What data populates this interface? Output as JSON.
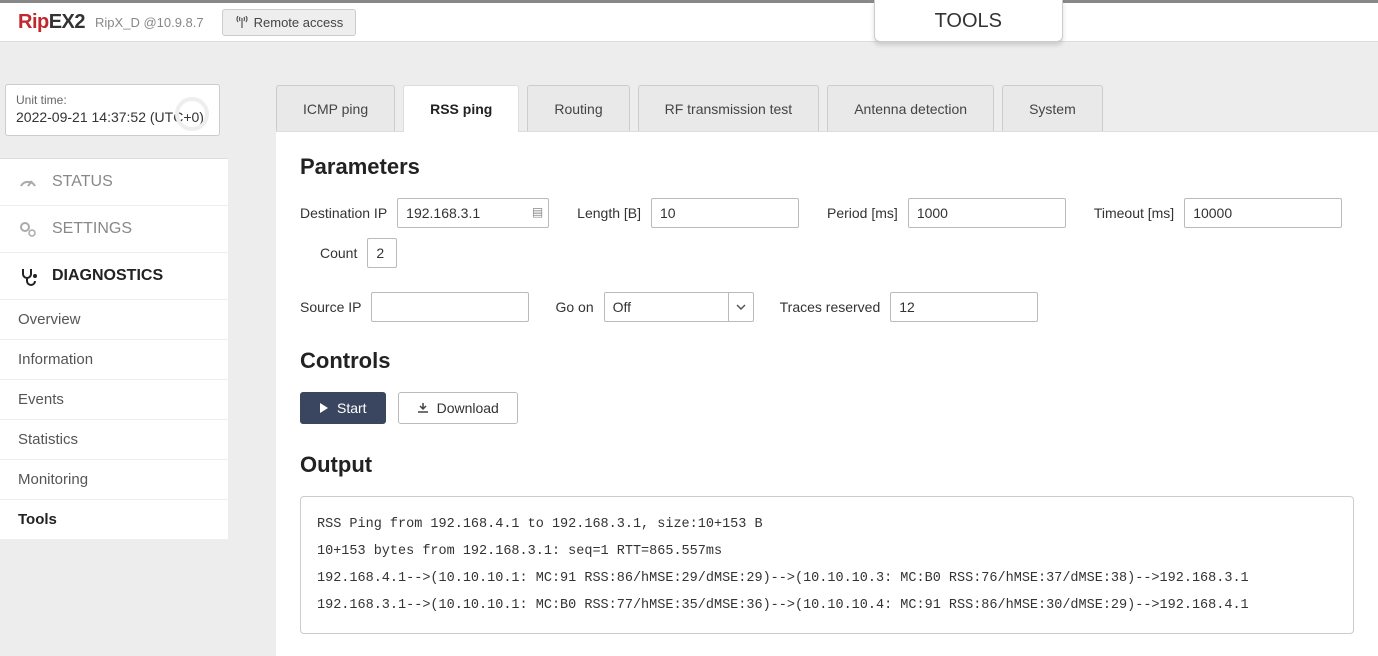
{
  "header": {
    "logo_a": "Rip",
    "logo_b": "EX2",
    "host": "RipX_D @10.9.8.7",
    "remote": "Remote access",
    "tab_right": "TOOLS"
  },
  "time": {
    "label": "Unit time:",
    "value": "2022-09-21 14:37:52 (UTC+0)"
  },
  "nav": {
    "status": "STATUS",
    "settings": "SETTINGS",
    "diagnostics": "DIAGNOSTICS",
    "sub": [
      "Overview",
      "Information",
      "Events",
      "Statistics",
      "Monitoring",
      "Tools"
    ]
  },
  "tabs": [
    "ICMP ping",
    "RSS ping",
    "Routing",
    "RF transmission test",
    "Antenna detection",
    "System"
  ],
  "sec": {
    "parameters": "Parameters",
    "controls": "Controls",
    "output": "Output"
  },
  "p": {
    "dest_ip_l": "Destination IP",
    "dest_ip_v": "192.168.3.1",
    "len_l": "Length [B]",
    "len_v": "10",
    "per_l": "Period [ms]",
    "per_v": "1000",
    "tmo_l": "Timeout [ms]",
    "tmo_v": "10000",
    "cnt_l": "Count",
    "cnt_v": "2",
    "src_l": "Source IP",
    "src_v": "",
    "go_l": "Go on",
    "go_v": "Off",
    "trc_l": "Traces reserved",
    "trc_v": "12"
  },
  "btn": {
    "start": "Start",
    "download": "Download"
  },
  "output_text": "RSS Ping from 192.168.4.1 to 192.168.3.1, size:10+153 B\n10+153 bytes from 192.168.3.1: seq=1 RTT=865.557ms\n192.168.4.1-->(10.10.10.1: MC:91 RSS:86/hMSE:29/dMSE:29)-->(10.10.10.3: MC:B0 RSS:76/hMSE:37/dMSE:38)-->192.168.3.1\n192.168.3.1-->(10.10.10.1: MC:B0 RSS:77/hMSE:35/dMSE:36)-->(10.10.10.4: MC:91 RSS:86/hMSE:30/dMSE:29)-->192.168.4.1"
}
